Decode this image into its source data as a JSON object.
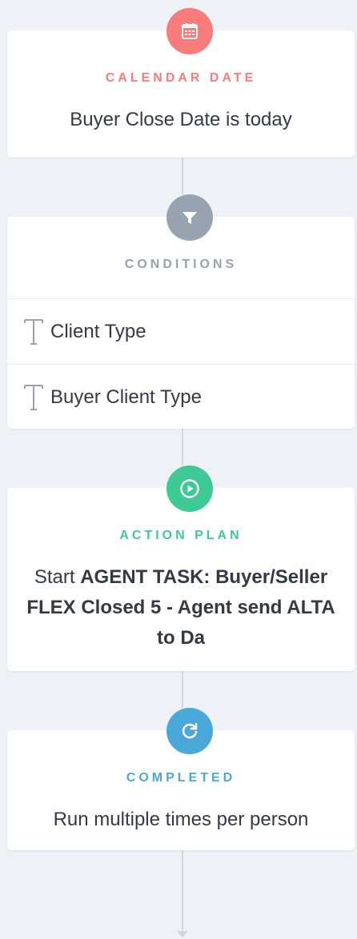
{
  "colors": {
    "calendar": "#f97b7b",
    "conditions": "#97a3b0",
    "action_plan": "#3ec995",
    "completed": "#4aa8d9"
  },
  "trigger": {
    "icon": "calendar-icon",
    "heading": "CALENDAR DATE",
    "text": "Buyer Close Date is today"
  },
  "conditions": {
    "icon": "filter-icon",
    "heading": "CONDITIONS",
    "items": [
      {
        "icon": "text-field-icon",
        "label": "Client Type"
      },
      {
        "icon": "text-field-icon",
        "label": "Buyer Client Type"
      }
    ]
  },
  "action": {
    "icon": "play-icon",
    "heading": "ACTION PLAN",
    "prefix": "Start",
    "name": "AGENT TASK: Buyer/Seller FLEX Closed 5 - Agent send ALTA to Da"
  },
  "completed": {
    "icon": "refresh-icon",
    "heading": "COMPLETED",
    "text": "Run multiple times per person"
  }
}
